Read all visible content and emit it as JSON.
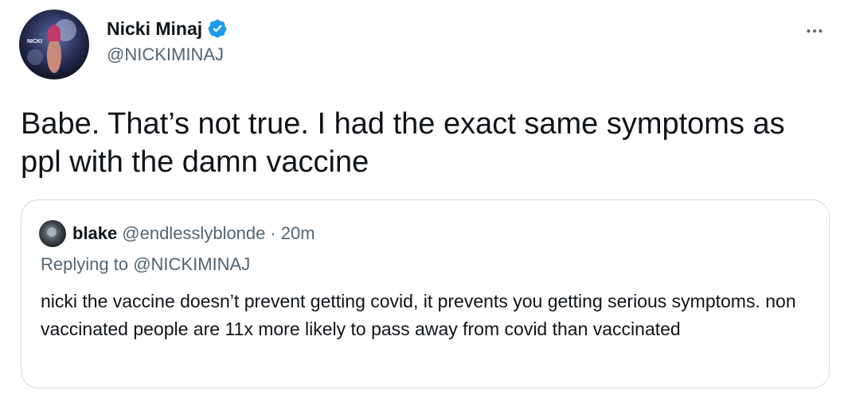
{
  "tweet": {
    "author": {
      "display_name": "Nicki Minaj",
      "handle": "@NICKIMINAJ",
      "verified": true,
      "avatar_icon": "profile-photo",
      "avatar_text": "NICKI"
    },
    "more_icon": "more-horizontal-icon",
    "text": "Babe. That’s not true. I had the exact same symptoms as ppl with the damn vaccine"
  },
  "quoted_tweet": {
    "author": {
      "display_name": "blake",
      "handle": "@endlesslyblonde",
      "separator": "·",
      "timestamp": "20m",
      "avatar_icon": "profile-photo"
    },
    "replying_to_label": "Replying to",
    "replying_to_handle": "@NICKIMINAJ",
    "text": "nicki the vaccine doesn’t prevent getting covid, it prevents you getting serious symptoms. non vaccinated people are 11x more likely to pass away from covid than vaccinated"
  },
  "colors": {
    "text_primary": "#0f1419",
    "text_secondary": "#536471",
    "verified_blue": "#1d9bf0",
    "border": "#cfd9de"
  }
}
